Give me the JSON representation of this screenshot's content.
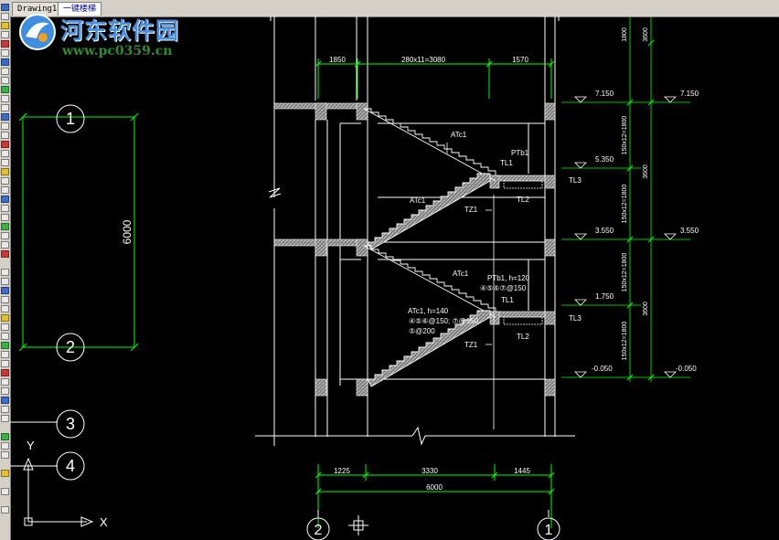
{
  "tabs": [
    {
      "label": "Drawing1",
      "active": false
    },
    {
      "label": "一键楼梯",
      "active": true
    }
  ],
  "watermark": {
    "title": "河东软件园",
    "url": "www.pc0359.cn",
    "title_color": "#4a8fe0",
    "url_color": "#2e8b2e"
  },
  "colors": {
    "background": "#000000",
    "structure": "#ffffff",
    "dimension": "#00ff00",
    "annotation": "#ffffff",
    "hatch": "#9a9a9a"
  },
  "grid_bubbles": {
    "left_vertical": [
      "1",
      "2",
      "3",
      "4"
    ],
    "bottom": [
      "2",
      "1"
    ]
  },
  "ucs": {
    "x_label": "X",
    "y_label": "Y"
  },
  "dimensions": {
    "left_span": "6000",
    "top": [
      "1850",
      "280x11=3080",
      "1570"
    ],
    "bottom_row1": [
      "1225",
      "3330",
      "1445"
    ],
    "bottom_total": "6000",
    "right_inner": [
      "1800",
      "150x12=1800",
      "150x12=1800",
      "150x12=1800",
      "150x12=1800"
    ],
    "right_outer": [
      "3600",
      "3600",
      "3600"
    ]
  },
  "elevations": {
    "left": [
      "7.150",
      "5.350",
      "3.550",
      "1.750",
      "-0.050"
    ],
    "right": [
      "7.150",
      "3.550",
      "-0.050"
    ]
  },
  "labels": {
    "atc1_upper": "ATc1",
    "atc1_upper_flight": "ATc1",
    "ptb1_upper": "PTb1",
    "tl1_upper": "TL1",
    "tl2_upper": "TL2",
    "tl3_upper": "TL3",
    "tz1_upper": "TZ1",
    "atc1_lower": "ATc1",
    "ptb1_lower": "PTb1, h=120",
    "ptb1_lower_rebar": "④⑤⑥⑦@150",
    "tl1_lower": "TL1",
    "atc1_lower_flight": "ATc1, h=140",
    "atc1_lower_rebar1": "④⑤⑥@150; ⑦@150",
    "atc1_lower_rebar2": "⑤@200",
    "tz1_lower": "TZ1",
    "tl2_lower": "TL2",
    "tl3_lower": "TL3"
  }
}
